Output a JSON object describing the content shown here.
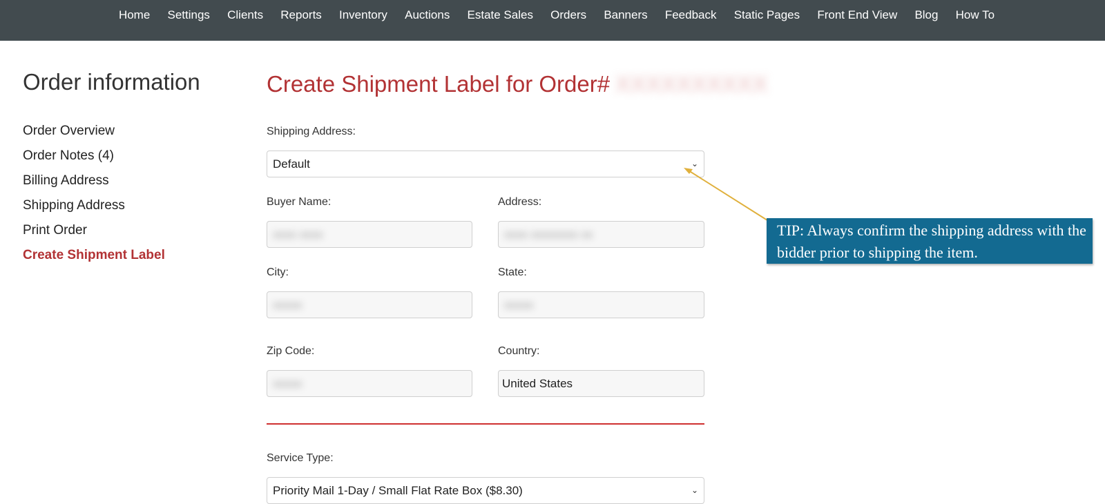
{
  "nav": {
    "items": [
      "Home",
      "Settings",
      "Clients",
      "Reports",
      "Inventory",
      "Auctions",
      "Estate Sales",
      "Orders",
      "Banners",
      "Feedback",
      "Static Pages",
      "Front End View",
      "Blog",
      "How To"
    ]
  },
  "sidebar": {
    "title": "Order information",
    "items": [
      {
        "label": "Order Overview"
      },
      {
        "label": "Order Notes (4)"
      },
      {
        "label": "Billing Address"
      },
      {
        "label": "Shipping Address"
      },
      {
        "label": "Print Order"
      },
      {
        "label": "Create Shipment Label"
      }
    ]
  },
  "main": {
    "title": "Create Shipment Label for Order#",
    "shipping_address_label": "Shipping Address:",
    "shipping_address_value": "Default",
    "buyer_name_label": "Buyer Name:",
    "address_label": "Address:",
    "city_label": "City:",
    "state_label": "State:",
    "zip_label": "Zip Code:",
    "country_label": "Country:",
    "country_value": "United States",
    "service_type_label": "Service Type:",
    "service_type_value": "Priority Mail 1-Day / Small Flat Rate Box ($8.30)"
  },
  "tip": {
    "text": "TIP: Always confirm the shipping address with the bidder prior to shipping the item."
  },
  "colors": {
    "nav_bg": "#424b4f",
    "accent_red": "#b23234",
    "tip_bg": "#136a91",
    "arrow": "#e0b03c"
  }
}
